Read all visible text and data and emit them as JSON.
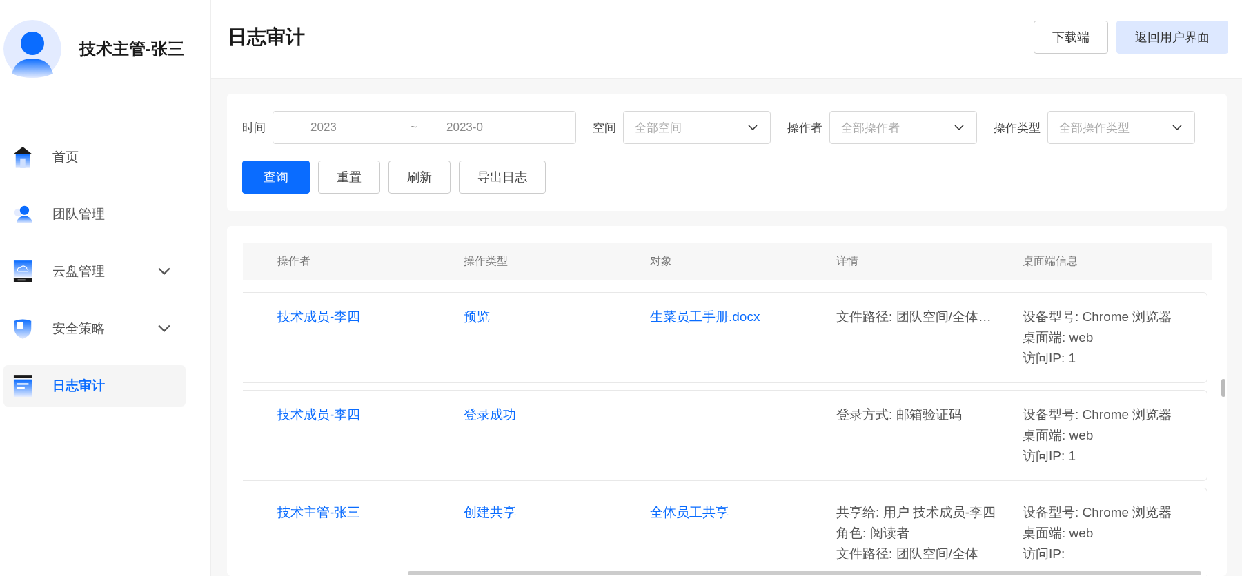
{
  "user": {
    "name": "技术主管-张三"
  },
  "sidebar": {
    "items": [
      {
        "label": "首页",
        "selected": false,
        "has_submenu": false
      },
      {
        "label": "团队管理",
        "selected": false,
        "has_submenu": false
      },
      {
        "label": "云盘管理",
        "selected": false,
        "has_submenu": true
      },
      {
        "label": "安全策略",
        "selected": false,
        "has_submenu": true
      },
      {
        "label": "日志审计",
        "selected": true,
        "has_submenu": false
      }
    ]
  },
  "page": {
    "title": "日志审计"
  },
  "header_buttons": [
    {
      "label": "下载端",
      "kind": "outline"
    },
    {
      "label": "返回用户界面",
      "kind": "light"
    }
  ],
  "filters": {
    "time": {
      "label": "时间",
      "start": "2023",
      "separator": "~",
      "end": "2023-0"
    },
    "selects": [
      {
        "label": "空间",
        "placeholder": "全部空间"
      },
      {
        "label": "操作者",
        "placeholder": "全部操作者"
      },
      {
        "label": "操作类型",
        "placeholder": "全部操作类型"
      }
    ],
    "buttons": [
      {
        "label": "查询",
        "primary": true
      },
      {
        "label": "重置",
        "primary": false
      },
      {
        "label": "刷新",
        "primary": false
      },
      {
        "label": "导出日志",
        "primary": false
      }
    ]
  },
  "table": {
    "columns": [
      "操作者",
      "操作类型",
      "对象",
      "详情",
      "桌面端信息"
    ],
    "rows": [
      {
        "operator": "技术成员-李四",
        "type": "预览",
        "object": "生菜员工手册.docx",
        "details": [
          "文件路径: 团队空间/全体…"
        ],
        "desktop": [
          "设备型号: Chrome 浏览器",
          "桌面端: web",
          "访问IP: 1"
        ]
      },
      {
        "operator": "技术成员-李四",
        "type": "登录成功",
        "object": "",
        "details": [
          "登录方式: 邮箱验证码"
        ],
        "desktop": [
          "设备型号: Chrome 浏览器",
          "桌面端: web",
          "访问IP: 1"
        ]
      },
      {
        "operator": "技术主管-张三",
        "type": "创建共享",
        "object": "全体员工共享",
        "details": [
          "共享给: 用户 技术成员-李四",
          "角色: 阅读者",
          "文件路径: 团队空间/全体"
        ],
        "desktop": [
          "设备型号: Chrome 浏览器",
          "桌面端: web",
          "访问IP:"
        ]
      }
    ]
  }
}
